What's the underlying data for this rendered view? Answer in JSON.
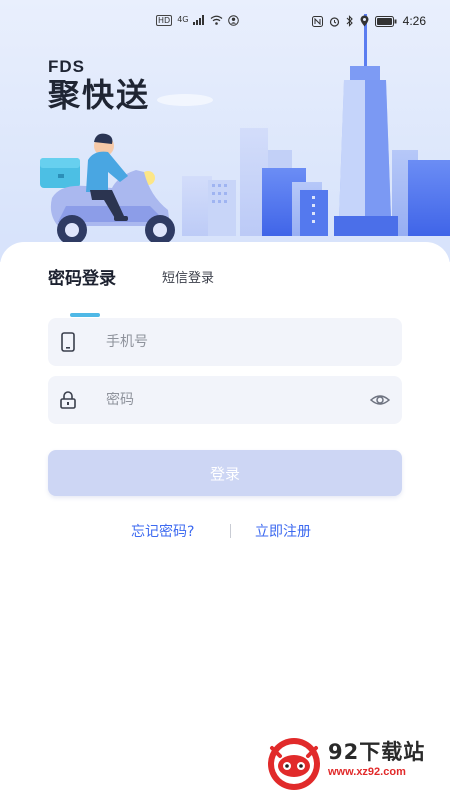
{
  "status_bar": {
    "left_chips": [
      "HD",
      "4G"
    ],
    "time": "4:26",
    "icons": [
      "signal-icon",
      "wifi-icon",
      "account-icon",
      "nfc-icon",
      "alarm-icon",
      "bluetooth-icon",
      "location-icon",
      "battery-icon"
    ]
  },
  "brand": {
    "en": "FDS",
    "cn_part1": "聚",
    "cn_part2": "快送"
  },
  "tabs": {
    "active": "密码登录",
    "inactive": "短信登录"
  },
  "form": {
    "phone_placeholder": "手机号",
    "password_placeholder": "密码",
    "login_label": "登录"
  },
  "links": {
    "forgot": "忘记密码?",
    "register": "立即注册"
  },
  "watermark": {
    "title": "92下载站",
    "url": "www.xz92.com"
  },
  "colors": {
    "accent": "#3d6af0",
    "tab_indicator": "#4fb8e6",
    "button_disabled": "#cdd6f4",
    "field_bg": "#f2f4fa"
  }
}
